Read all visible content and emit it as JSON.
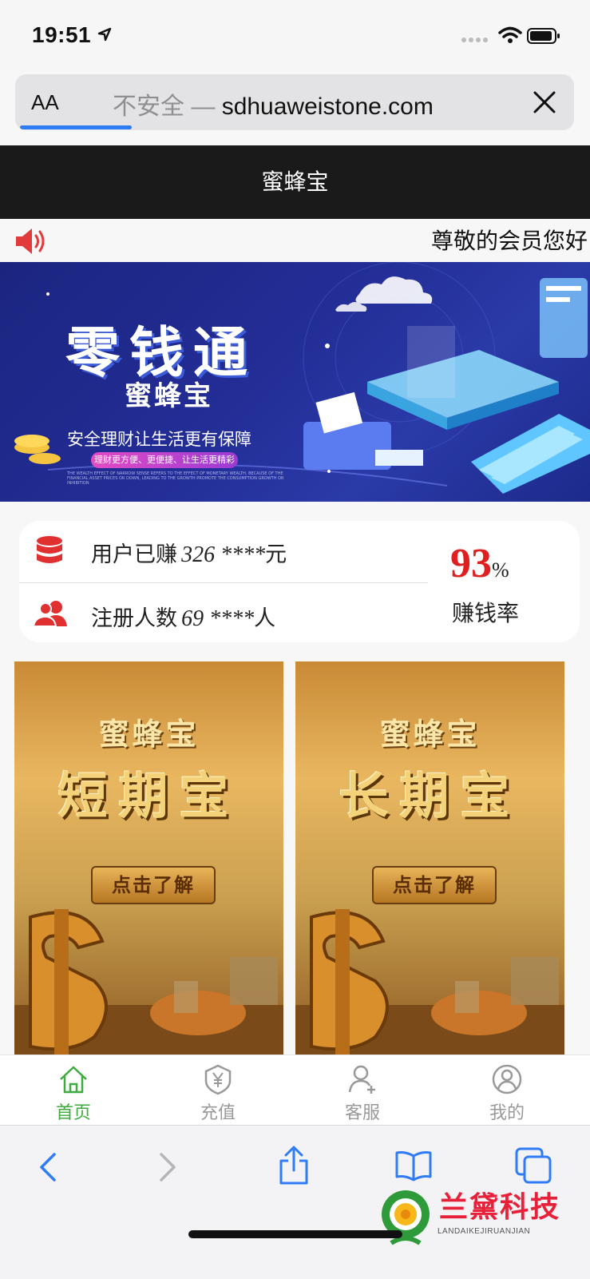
{
  "status_bar": {
    "time": "19:51"
  },
  "browser": {
    "text_size_button": "AA",
    "url_security": "不安全 —",
    "url_host": "sdhuaweistone.com"
  },
  "site": {
    "header_title": "蜜蜂宝",
    "notice": "尊敬的会员您好",
    "banner": {
      "title": "零钱通",
      "brand": "蜜蜂宝",
      "slogan": "安全理财让生活更有保障",
      "pill": "理财更方便、更便捷、让生活更精彩",
      "fine_print": "THE WEALTH EFFECT OF NARROW SENSE REFERS TO THE EFFECT OF MONETARY WEALTH, BECAUSE OF THE FINANCIAL ASSET PRICES OR DOWN, LEADING TO THE GROWTH PROMOTE THE CONSUMPTION GROWTH OR INHIBITION"
    },
    "stats": {
      "earned_label": "用户已赚",
      "earned_value": "326 ****",
      "earned_unit": "元",
      "users_label": "注册人数",
      "users_value": "69 ****",
      "users_unit": "人",
      "rate_value": "93",
      "rate_unit": "%",
      "rate_label": "赚钱率"
    },
    "products": [
      {
        "brand": "蜜蜂宝",
        "title": "短期宝",
        "button": "点击了解"
      },
      {
        "brand": "蜜蜂宝",
        "title": "长期宝",
        "button": "点击了解"
      }
    ],
    "tabs": [
      {
        "label": "首页",
        "icon": "home-icon",
        "active": true
      },
      {
        "label": "充值",
        "icon": "yuan-shield-icon",
        "active": false
      },
      {
        "label": "客服",
        "icon": "add-user-icon",
        "active": false
      },
      {
        "label": "我的",
        "icon": "profile-icon",
        "active": false
      }
    ],
    "accent_color": "#3eab3e",
    "rate_color": "#e02020"
  },
  "watermark": {
    "text": "兰黛科技",
    "sub": "LANDAIKEJIRUANJIAN"
  }
}
